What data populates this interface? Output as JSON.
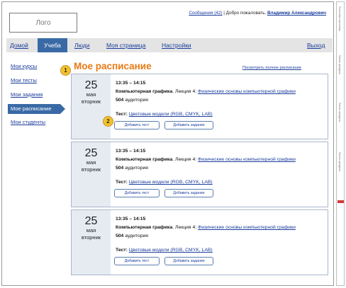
{
  "header": {
    "logo": "Лого",
    "messages_link": "Сообщения (42)",
    "separator": "|",
    "greeting": "Добро пожаловать,",
    "user_name": "Владимир Александрович"
  },
  "nav": {
    "home": "Домой",
    "study": "Учеба",
    "people": "Люди",
    "my_page": "Моя страница",
    "settings": "Настройки",
    "logout": "Выход"
  },
  "sidebar": {
    "items": [
      {
        "label": "Мои курсы"
      },
      {
        "label": "Мои тесты"
      },
      {
        "label": "Мои задания"
      },
      {
        "label": "Мое расписание"
      },
      {
        "label": "Мои студенты"
      }
    ]
  },
  "main": {
    "title": "Мое расписание",
    "full_schedule_link": "Посмотреть полное расписание"
  },
  "markers": [
    "1",
    "2"
  ],
  "schedule": [
    {
      "day": "25",
      "month": "мая",
      "weekday": "вторник",
      "time": "13:35 – 14:15",
      "course": "Компьютерная графика",
      "lecture_prefix": ". Лекция 4:",
      "lecture_link": "Физические основы компьютерной графики",
      "room_num": "504",
      "room_label": "аудитория",
      "test_label": "Тест",
      "test_link": "Цветовые модели (RGB, CMYK, LAB)",
      "add_test": "Добавить тест",
      "add_task": "Добавить задание"
    },
    {
      "day": "25",
      "month": "мая",
      "weekday": "вторник",
      "time": "13:35 – 14:15",
      "course": "Компьютерная графика",
      "lecture_prefix": ". Лекция 4:",
      "lecture_link": "Физические основы компьютерной графики",
      "room_num": "504",
      "room_label": "аудитория",
      "test_label": "Тест",
      "test_link": "Цветовые модели (RGB, CMYK, LAB)",
      "add_test": "Добавить тест",
      "add_task": "Добавить задание"
    },
    {
      "day": "25",
      "month": "мая",
      "weekday": "вторник",
      "time": "13:35 – 14:15",
      "course": "Компьютерная графика",
      "lecture_prefix": ". Лекция 4:",
      "lecture_link": "Физические основы компьютерной графики",
      "room_num": "504",
      "room_label": "аудитория",
      "test_label": "Тест",
      "test_link": "Цветовые модели (RGB, CMYK, LAB)",
      "add_test": "Добавить тест",
      "add_task": "Добавить задание"
    }
  ],
  "side_panel": {
    "labels": [
      "Пояснение к прототипу",
      "Панель прокрутки",
      "Панель прокрутки",
      "Панель прокрутки"
    ]
  },
  "colors": {
    "accent": "#3a6aa6",
    "title_orange": "#e87a14",
    "link": "#1a3c9c",
    "marker": "#f1c232",
    "date_bg": "#e6ebf2"
  }
}
